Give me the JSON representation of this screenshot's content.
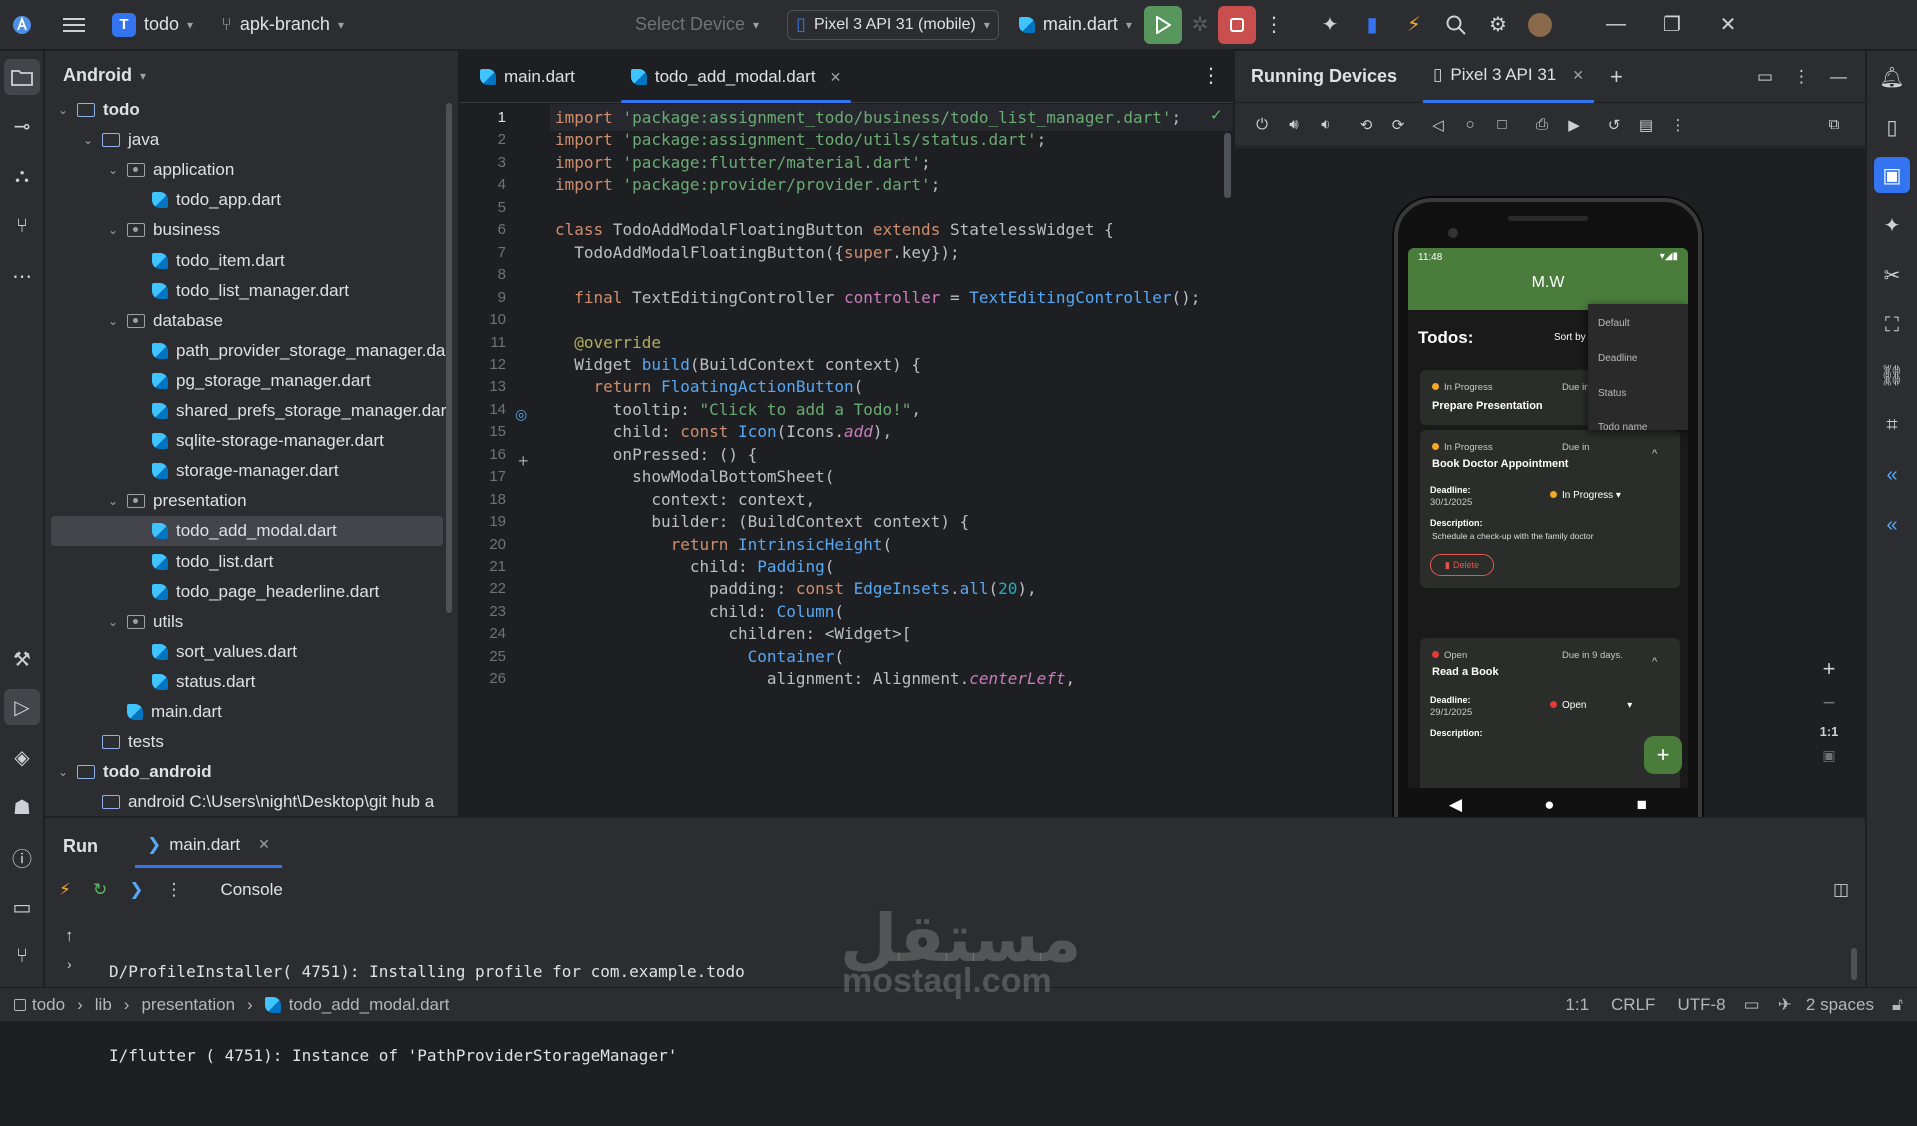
{
  "titlebar": {
    "project_initial": "T",
    "project": "todo",
    "branch": "apk-branch",
    "select_device": "Select Device",
    "device": "Pixel 3 API 31 (mobile)",
    "run_config": "main.dart"
  },
  "project_panel": {
    "title": "Android",
    "tree": [
      {
        "label": "todo",
        "kind": "module",
        "level": 0,
        "expanded": true
      },
      {
        "label": "java",
        "kind": "folder",
        "level": 1,
        "expanded": true
      },
      {
        "label": "application",
        "kind": "package",
        "level": 2,
        "expanded": true
      },
      {
        "label": "todo_app.dart",
        "kind": "dart",
        "level": 3
      },
      {
        "label": "business",
        "kind": "package",
        "level": 2,
        "expanded": true
      },
      {
        "label": "todo_item.dart",
        "kind": "dart",
        "level": 3
      },
      {
        "label": "todo_list_manager.dart",
        "kind": "dart",
        "level": 3
      },
      {
        "label": "database",
        "kind": "package",
        "level": 2,
        "expanded": true
      },
      {
        "label": "path_provider_storage_manager.dar",
        "kind": "dart",
        "level": 3
      },
      {
        "label": "pg_storage_manager.dart",
        "kind": "dart",
        "level": 3
      },
      {
        "label": "shared_prefs_storage_manager.dart",
        "kind": "dart",
        "level": 3
      },
      {
        "label": "sqlite-storage-manager.dart",
        "kind": "dart",
        "level": 3
      },
      {
        "label": "storage-manager.dart",
        "kind": "dart",
        "level": 3
      },
      {
        "label": "presentation",
        "kind": "package",
        "level": 2,
        "expanded": true
      },
      {
        "label": "todo_add_modal.dart",
        "kind": "dart",
        "level": 3,
        "selected": true
      },
      {
        "label": "todo_list.dart",
        "kind": "dart",
        "level": 3
      },
      {
        "label": "todo_page_headerline.dart",
        "kind": "dart",
        "level": 3
      },
      {
        "label": "utils",
        "kind": "package",
        "level": 2,
        "expanded": true
      },
      {
        "label": "sort_values.dart",
        "kind": "dart",
        "level": 3
      },
      {
        "label": "status.dart",
        "kind": "dart",
        "level": 3
      },
      {
        "label": "main.dart",
        "kind": "dart",
        "level": 2
      },
      {
        "label": "tests",
        "kind": "folder",
        "level": 1
      },
      {
        "label": "todo_android",
        "kind": "module",
        "level": 0,
        "expanded": true
      },
      {
        "label": "android  C:\\Users\\night\\Desktop\\git hub a",
        "kind": "folder",
        "level": 1
      }
    ]
  },
  "editor": {
    "tabs": [
      {
        "label": "main.dart",
        "active": false
      },
      {
        "label": "todo_add_modal.dart",
        "active": true
      }
    ],
    "lines": [
      "import 'package:assignment_todo/business/todo_list_manager.dart';",
      "import 'package:assignment_todo/utils/status.dart';",
      "import 'package:flutter/material.dart';",
      "import 'package:provider/provider.dart';",
      "",
      "class TodoAddModalFloatingButton extends StatelessWidget {",
      "  TodoAddModalFloatingButton({super.key});",
      "",
      "  final TextEditingController controller = TextEditingController();",
      "",
      "  @override",
      "  Widget build(BuildContext context) {",
      "    return FloatingActionButton(",
      "      tooltip: \"Click to add a Todo!\",",
      "      child: const Icon(Icons.add),",
      "      onPressed: () {",
      "        showModalBottomSheet(",
      "          context: context,",
      "          builder: (BuildContext context) {",
      "            return IntrinsicHeight(",
      "              child: Padding(",
      "                padding: const EdgeInsets.all(20),",
      "                child: Column(",
      "                  children: <Widget>[",
      "                    Container(",
      "                      alignment: Alignment.centerLeft,"
    ]
  },
  "devices": {
    "panel_title": "Running Devices",
    "device_tab": "Pixel 3 API 31",
    "zoom_label": "1:1",
    "phone": {
      "time": "11:48",
      "app_title": "M.W",
      "todos_label": "Todos:",
      "sort_by": "Sort by",
      "sort_options": [
        "Default",
        "Deadline",
        "Status",
        "Todo name"
      ],
      "cards": [
        {
          "status": "In Progress",
          "status_color": "#f5a623",
          "due": "Due in",
          "title": "Prepare Presentation"
        },
        {
          "status": "In Progress",
          "status_color": "#f5a623",
          "due": "Due in",
          "title": "Book Doctor Appointment",
          "deadline_label": "Deadline:",
          "deadline": "30/1/2025",
          "dropdown": "In Progress",
          "desc_label": "Description:",
          "desc": "Schedule a check-up with the family doctor",
          "delete": "Delete"
        },
        {
          "status": "Open",
          "status_color": "#e53935",
          "due": "Due in 9 days.",
          "title": "Read a Book",
          "deadline_label": "Deadline:",
          "deadline": "29/1/2025",
          "dropdown": "Open",
          "desc_label": "Description:"
        }
      ]
    }
  },
  "run_panel": {
    "title": "Run",
    "tab": "main.dart",
    "console_label": "Console",
    "log": [
      "D/ProfileInstaller( 4751): Installing profile for com.example.todo",
      "I/flutter ( 4751): Instance of 'PathProviderStorageManager'"
    ]
  },
  "statusbar": {
    "crumbs": [
      "todo",
      "lib",
      "presentation",
      "todo_add_modal.dart"
    ],
    "position": "1:1",
    "line_sep": "CRLF",
    "encoding": "UTF-8",
    "indent": "2 spaces"
  },
  "watermark": {
    "arabic": "مستقل",
    "latin": "mostaql.com"
  }
}
